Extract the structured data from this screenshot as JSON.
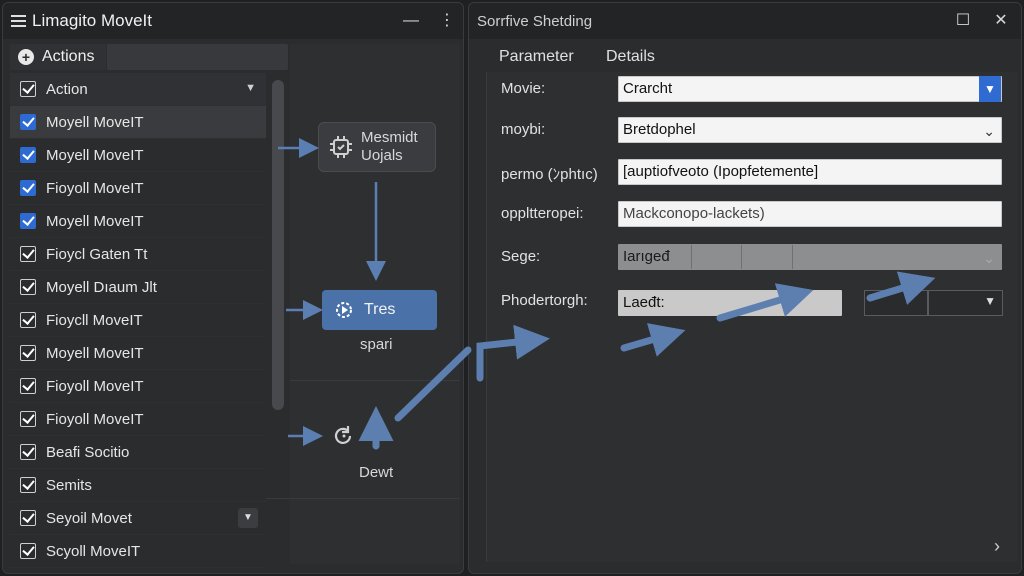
{
  "left_window": {
    "title": "Limagito MoveIt",
    "minimize": "—",
    "more": "⋮"
  },
  "actions_panel": {
    "header_label": "Actions",
    "rows": [
      {
        "label": "Action",
        "checkbox": "outline",
        "header": true
      },
      {
        "label": "Moyell MoveIT",
        "checkbox": "blue",
        "selected": true
      },
      {
        "label": "Moyell MoveIT",
        "checkbox": "blue"
      },
      {
        "label": "Fioyoll MoveIT",
        "checkbox": "blue"
      },
      {
        "label": "Moyell MoveIT",
        "checkbox": "blue"
      },
      {
        "label": "Fioycl Gaten Tt",
        "checkbox": "outline"
      },
      {
        "label": "Moyell Dıaum Jlt",
        "checkbox": "outline"
      },
      {
        "label": "Fioycll MoveIT",
        "checkbox": "outline"
      },
      {
        "label": "Moyell MoveIT",
        "checkbox": "outline"
      },
      {
        "label": "Fioyoll MoveIT",
        "checkbox": "outline"
      },
      {
        "label": "Fioyoll MoveIT",
        "checkbox": "outline"
      },
      {
        "label": "Beafi Socitio",
        "checkbox": "outline"
      },
      {
        "label": "Semits",
        "checkbox": "outline"
      },
      {
        "label": "Seyoil Movet",
        "checkbox": "outline",
        "has_button": true
      },
      {
        "label": "Scyoll MoveIT",
        "checkbox": "outline"
      }
    ]
  },
  "flow": {
    "node1_line1": "Mesmidt",
    "node1_line2": "Uojals",
    "node2_label": "Tres",
    "node2_caption": "spari",
    "node3_caption": "Dewt",
    "accent_color": "#4a72a9"
  },
  "right_window": {
    "title": "Sorrfive Shetding",
    "maximize": "☐",
    "close": "✕",
    "columns": [
      "Parameter",
      "Details"
    ],
    "params": [
      {
        "label": "Movie:",
        "value": "Crarcht"
      },
      {
        "label": "moybi:",
        "value": "Bretdophel"
      },
      {
        "label": "permo (ﾝphtıc)",
        "value": "[auptiofveoto (Ipopfetemente]"
      },
      {
        "label": "oppltteropei:",
        "value": "Mackconopo-lackets)"
      },
      {
        "label": "Sege:",
        "value": "Iarıgeđ"
      },
      {
        "label": "Phodertorgh:",
        "value": "Laeđt:"
      }
    ]
  }
}
